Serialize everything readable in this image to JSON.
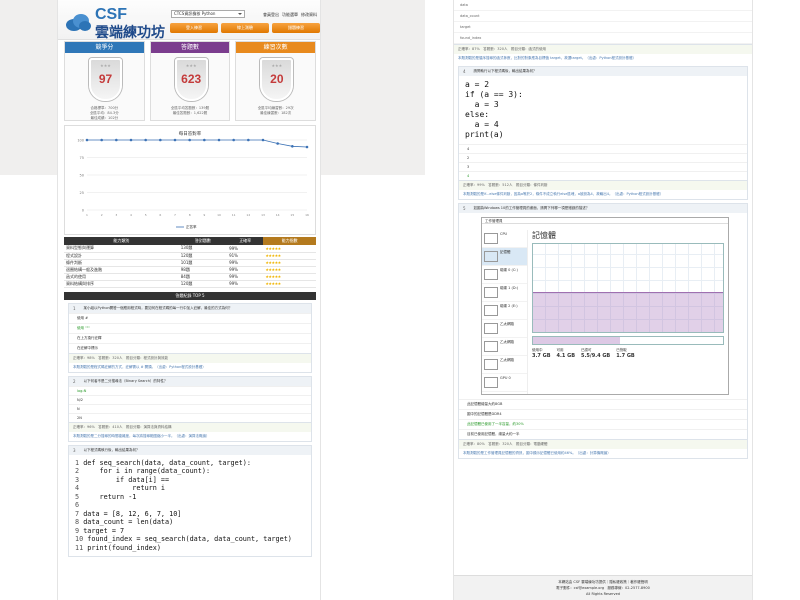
{
  "header": {
    "logo_top": "CSF",
    "logo_bottom": "雲端練功坊",
    "select_value": "CTCS資訊檢核 Python",
    "links": [
      "會員登出",
      "功能選單",
      "修改資料"
    ],
    "buttons": [
      "登入練習",
      "線上測驗",
      "錯題練習"
    ]
  },
  "cards": [
    {
      "title": "競爭分",
      "value": "97",
      "unit": "分",
      "lines": [
        "合格標準：700分",
        "全區平均：84.3分",
        "最佳成績：102分"
      ],
      "color": "#2f77b8"
    },
    {
      "title": "答題數",
      "value": "623",
      "unit": "題",
      "lines": [
        "全區平均答題數：139題",
        "最佳答題數：1,622題"
      ],
      "color": "#7b3d8e"
    },
    {
      "title": "練習次數",
      "value": "20",
      "unit": "次",
      "lines": [
        "全區平均練習數：29次",
        "最佳練習數：182次"
      ],
      "color": "#e88a1e"
    }
  ],
  "chart_data": {
    "type": "line",
    "title": "每日答對率",
    "x": [
      "1",
      "2",
      "3",
      "4",
      "5",
      "6",
      "7",
      "8",
      "9",
      "10",
      "11",
      "12",
      "13",
      "14",
      "15",
      "16"
    ],
    "series": [
      {
        "name": "正答率",
        "values": [
          100,
          100,
          100,
          100,
          100,
          100,
          100,
          100,
          100,
          100,
          100,
          100,
          100,
          95,
          91,
          90
        ],
        "color": "#3c72b5"
      }
    ],
    "yticks": [
      0,
      25,
      50,
      75,
      100
    ],
    "ylim": [
      0,
      100
    ],
    "legend": "bottom-center",
    "grid": true
  },
  "score_table": {
    "headers": [
      "能力類別",
      "答對題數",
      "正確率",
      "能力指數"
    ],
    "rows": [
      [
        "資料型態與運算",
        "130題",
        "99%",
        "★★★★★"
      ],
      [
        "程式設計",
        "120題",
        "91%",
        "★★★★★"
      ],
      [
        "條件判斷",
        "101題",
        "99%",
        "★★★★★"
      ],
      [
        "迴圈結構一般及進階",
        "98題",
        "99%",
        "★★★★★"
      ],
      [
        "函式的使用",
        "84題",
        "99%",
        "★★★★★"
      ],
      [
        "資料結構與排序",
        "120題",
        "99%",
        "★★★★★"
      ]
    ],
    "section_title": "答題紀錄 TOP 5"
  },
  "left_questions": [
    {
      "num": "1",
      "text": "某小組以Python開發一個應用程式時，要如何在程式碼的每一行中加入註解，最佳的方式為何？",
      "options": [
        "使用 #",
        "使用 \"\"\" ",
        "在上方換行註釋",
        "在註解中標示"
      ],
      "correct_index": 1,
      "meta": "正確率：98%　答題數：320人　題目分類：程式設計與效能",
      "expl": "本題測驗的是程式碼註解的方式，註解需以 # 開頭。（出處：Python程式設計基礎）"
    },
    {
      "num": "2",
      "text": "以下何者不是二分搜尋法（Binary Search）的特性？",
      "options": [
        "log₂N",
        "N/2",
        "N",
        "2N"
      ],
      "correct_index": 0,
      "meta": "正確率：96%　答題數：410人　題目分類：演算法與資料結構",
      "expl": "本題測驗的是二分搜尋的時間複雜度，每次將搜尋範圍縮小一半。（出處：演算法概論）"
    },
    {
      "num": "3",
      "text": "以下程式碼執行後，輸出結果為何？"
    }
  ],
  "code_search": [
    {
      "n": "1",
      "t": "def seq_search(data, data_count, target):"
    },
    {
      "n": "2",
      "t": "    for i in range(data_count):"
    },
    {
      "n": "3",
      "t": "        if data[i] == "
    },
    {
      "n": "4",
      "t": "            return i"
    },
    {
      "n": "5",
      "t": "    return -1"
    },
    {
      "n": "6",
      "t": ""
    },
    {
      "n": "7",
      "t": "data = [8, 12, 6, 7, 10]"
    },
    {
      "n": "8",
      "t": "data_count = len(data)"
    },
    {
      "n": "9",
      "t": "target = 7"
    },
    {
      "n": "10",
      "t": "found_index = seq_search(data, data_count, target)"
    },
    {
      "n": "11",
      "t": "print(found_index)"
    }
  ],
  "right_top_options": [
    "data",
    "data_count",
    "target",
    "found_index"
  ],
  "right_q1_meta": "正確率：87%　答題數：320人　題目分類：函式的使用",
  "right_q1_expl": "本題測驗的是循序搜尋的函式參數，比對的對象應為目標值 target，故選target。（出處：Python程式設計基礎）",
  "q4": {
    "num": "4",
    "text": "請問執行以下程式碼後，輸出結果為何？",
    "code": [
      "a = 2",
      "if (a == 3):",
      "  a = 3",
      "else:",
      "  a = 4",
      "",
      "print(a)"
    ],
    "options": [
      "4",
      "2",
      "3",
      "4"
    ],
    "meta": "正確率：99%　答題數：512人　題目分類：條件判斷",
    "expl": "本題測驗的是if...else條件判斷，因為a等於2，條件不成立執行else區塊，a被設為4，故輸出4。（出處：Python程式設計基礎）"
  },
  "q5": {
    "num": "5",
    "text": "如圖為Windows 10的工作管理員的畫面，請問下列哪一項是錯誤的描述？",
    "tm_title": "工作管理員",
    "tm_heading": "記憶體",
    "tm_sidebar": [
      "CPU",
      "記憶體",
      "磁碟 0 (C:)",
      "磁碟 1 (D:)",
      "磁碟 2 (E:)",
      "乙太網路",
      "乙太網路",
      "乙太網路",
      "GPU 0"
    ],
    "tm_stats": [
      {
        "label": "使用中",
        "value": "3.7 GB"
      },
      {
        "label": "可用",
        "value": "4.1 GB"
      },
      {
        "label": "已認可",
        "value": "5.5/9.4 GB"
      },
      {
        "label": "已快取",
        "value": "1.7 GB"
      }
    ],
    "tm_memory_fraction": 0.46,
    "options": [
      "此記憶體總量大約8GB",
      "圖中的記憶體是DDR4",
      "此記憶體已使用了一半容量，約30%",
      "目前已使用記憶體，總量大約一半"
    ],
    "meta": "正確率：80%　答題數：320人　題目分類：電腦硬體",
    "expl": "本題測驗的是工作管理員記憶體的資訊，圖中顯示記憶體已使用約46%。（出處：計算機概論）"
  },
  "footer": {
    "lines": [
      "本網站由 CSF 雲端練功坊提供｜隱私權政策｜著作權聲明",
      "電子郵件：csf@example.org　服務專線：02-2577-8900",
      "All Rights Reserved"
    ]
  }
}
